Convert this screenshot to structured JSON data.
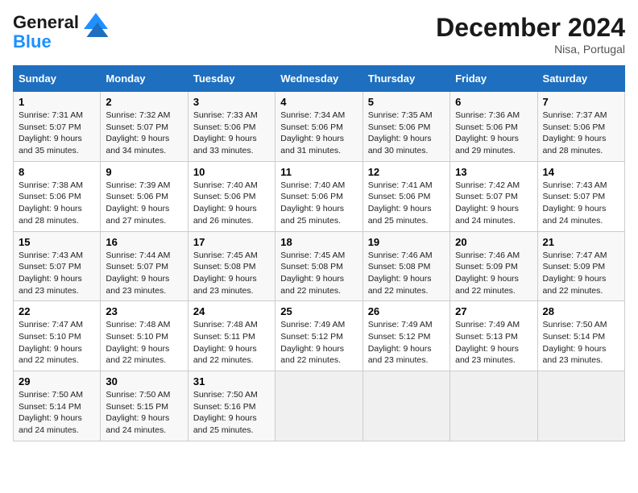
{
  "logo": {
    "line1": "General",
    "line2": "Blue"
  },
  "title": "December 2024",
  "location": "Nisa, Portugal",
  "weekdays": [
    "Sunday",
    "Monday",
    "Tuesday",
    "Wednesday",
    "Thursday",
    "Friday",
    "Saturday"
  ],
  "weeks": [
    [
      {
        "day": "1",
        "sunrise": "Sunrise: 7:31 AM",
        "sunset": "Sunset: 5:07 PM",
        "daylight": "Daylight: 9 hours and 35 minutes."
      },
      {
        "day": "2",
        "sunrise": "Sunrise: 7:32 AM",
        "sunset": "Sunset: 5:07 PM",
        "daylight": "Daylight: 9 hours and 34 minutes."
      },
      {
        "day": "3",
        "sunrise": "Sunrise: 7:33 AM",
        "sunset": "Sunset: 5:06 PM",
        "daylight": "Daylight: 9 hours and 33 minutes."
      },
      {
        "day": "4",
        "sunrise": "Sunrise: 7:34 AM",
        "sunset": "Sunset: 5:06 PM",
        "daylight": "Daylight: 9 hours and 31 minutes."
      },
      {
        "day": "5",
        "sunrise": "Sunrise: 7:35 AM",
        "sunset": "Sunset: 5:06 PM",
        "daylight": "Daylight: 9 hours and 30 minutes."
      },
      {
        "day": "6",
        "sunrise": "Sunrise: 7:36 AM",
        "sunset": "Sunset: 5:06 PM",
        "daylight": "Daylight: 9 hours and 29 minutes."
      },
      {
        "day": "7",
        "sunrise": "Sunrise: 7:37 AM",
        "sunset": "Sunset: 5:06 PM",
        "daylight": "Daylight: 9 hours and 28 minutes."
      }
    ],
    [
      {
        "day": "8",
        "sunrise": "Sunrise: 7:38 AM",
        "sunset": "Sunset: 5:06 PM",
        "daylight": "Daylight: 9 hours and 28 minutes."
      },
      {
        "day": "9",
        "sunrise": "Sunrise: 7:39 AM",
        "sunset": "Sunset: 5:06 PM",
        "daylight": "Daylight: 9 hours and 27 minutes."
      },
      {
        "day": "10",
        "sunrise": "Sunrise: 7:40 AM",
        "sunset": "Sunset: 5:06 PM",
        "daylight": "Daylight: 9 hours and 26 minutes."
      },
      {
        "day": "11",
        "sunrise": "Sunrise: 7:40 AM",
        "sunset": "Sunset: 5:06 PM",
        "daylight": "Daylight: 9 hours and 25 minutes."
      },
      {
        "day": "12",
        "sunrise": "Sunrise: 7:41 AM",
        "sunset": "Sunset: 5:06 PM",
        "daylight": "Daylight: 9 hours and 25 minutes."
      },
      {
        "day": "13",
        "sunrise": "Sunrise: 7:42 AM",
        "sunset": "Sunset: 5:07 PM",
        "daylight": "Daylight: 9 hours and 24 minutes."
      },
      {
        "day": "14",
        "sunrise": "Sunrise: 7:43 AM",
        "sunset": "Sunset: 5:07 PM",
        "daylight": "Daylight: 9 hours and 24 minutes."
      }
    ],
    [
      {
        "day": "15",
        "sunrise": "Sunrise: 7:43 AM",
        "sunset": "Sunset: 5:07 PM",
        "daylight": "Daylight: 9 hours and 23 minutes."
      },
      {
        "day": "16",
        "sunrise": "Sunrise: 7:44 AM",
        "sunset": "Sunset: 5:07 PM",
        "daylight": "Daylight: 9 hours and 23 minutes."
      },
      {
        "day": "17",
        "sunrise": "Sunrise: 7:45 AM",
        "sunset": "Sunset: 5:08 PM",
        "daylight": "Daylight: 9 hours and 23 minutes."
      },
      {
        "day": "18",
        "sunrise": "Sunrise: 7:45 AM",
        "sunset": "Sunset: 5:08 PM",
        "daylight": "Daylight: 9 hours and 22 minutes."
      },
      {
        "day": "19",
        "sunrise": "Sunrise: 7:46 AM",
        "sunset": "Sunset: 5:08 PM",
        "daylight": "Daylight: 9 hours and 22 minutes."
      },
      {
        "day": "20",
        "sunrise": "Sunrise: 7:46 AM",
        "sunset": "Sunset: 5:09 PM",
        "daylight": "Daylight: 9 hours and 22 minutes."
      },
      {
        "day": "21",
        "sunrise": "Sunrise: 7:47 AM",
        "sunset": "Sunset: 5:09 PM",
        "daylight": "Daylight: 9 hours and 22 minutes."
      }
    ],
    [
      {
        "day": "22",
        "sunrise": "Sunrise: 7:47 AM",
        "sunset": "Sunset: 5:10 PM",
        "daylight": "Daylight: 9 hours and 22 minutes."
      },
      {
        "day": "23",
        "sunrise": "Sunrise: 7:48 AM",
        "sunset": "Sunset: 5:10 PM",
        "daylight": "Daylight: 9 hours and 22 minutes."
      },
      {
        "day": "24",
        "sunrise": "Sunrise: 7:48 AM",
        "sunset": "Sunset: 5:11 PM",
        "daylight": "Daylight: 9 hours and 22 minutes."
      },
      {
        "day": "25",
        "sunrise": "Sunrise: 7:49 AM",
        "sunset": "Sunset: 5:12 PM",
        "daylight": "Daylight: 9 hours and 22 minutes."
      },
      {
        "day": "26",
        "sunrise": "Sunrise: 7:49 AM",
        "sunset": "Sunset: 5:12 PM",
        "daylight": "Daylight: 9 hours and 23 minutes."
      },
      {
        "day": "27",
        "sunrise": "Sunrise: 7:49 AM",
        "sunset": "Sunset: 5:13 PM",
        "daylight": "Daylight: 9 hours and 23 minutes."
      },
      {
        "day": "28",
        "sunrise": "Sunrise: 7:50 AM",
        "sunset": "Sunset: 5:14 PM",
        "daylight": "Daylight: 9 hours and 23 minutes."
      }
    ],
    [
      {
        "day": "29",
        "sunrise": "Sunrise: 7:50 AM",
        "sunset": "Sunset: 5:14 PM",
        "daylight": "Daylight: 9 hours and 24 minutes."
      },
      {
        "day": "30",
        "sunrise": "Sunrise: 7:50 AM",
        "sunset": "Sunset: 5:15 PM",
        "daylight": "Daylight: 9 hours and 24 minutes."
      },
      {
        "day": "31",
        "sunrise": "Sunrise: 7:50 AM",
        "sunset": "Sunset: 5:16 PM",
        "daylight": "Daylight: 9 hours and 25 minutes."
      },
      null,
      null,
      null,
      null
    ]
  ]
}
